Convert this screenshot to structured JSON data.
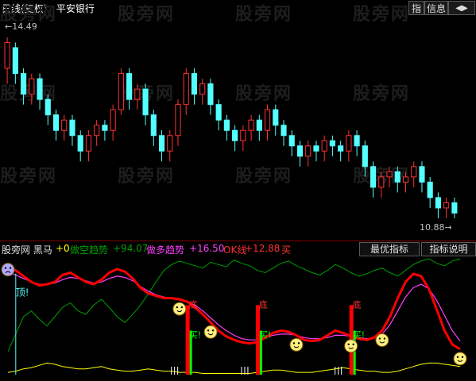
{
  "header": {
    "title": "日线(复权)",
    "stock": "平安银行",
    "btn_index": "指",
    "btn_info": "信息",
    "btn_sound": "◀▶"
  },
  "price_panel": {
    "high_label": "14.49",
    "low_label": "10.88"
  },
  "watermark": "股旁网",
  "indicator": {
    "name": "股旁网 黑马",
    "v0": "+0",
    "short_label": "做空趋势",
    "short_value": "+94.07",
    "long_label": "做多趋势",
    "long_value": "+16.50",
    "ok_label": "OK线",
    "ok_value": "+12.88",
    "buy_tag": "买",
    "btn_best": "最优指标",
    "btn_help": "指标说明",
    "tag_top": "顶!",
    "tag_bottom": "底",
    "tag_buy": "买!"
  },
  "colors": {
    "up": "#ff3232",
    "down": "#54ffff",
    "red_line": "#ff0000",
    "magenta_line": "#ff40ff",
    "green_line": "#00a000",
    "yellow_line": "#ffff00",
    "separator": "#800000"
  },
  "candles": [
    [
      13.8,
      14.3,
      13.6,
      14.4,
      13.5
    ],
    [
      14.2,
      13.7,
      13.6,
      14.3,
      13.5
    ],
    [
      13.7,
      13.3,
      13.2,
      13.8,
      13.1
    ],
    [
      13.3,
      13.6,
      13.2,
      13.7,
      13.1
    ],
    [
      13.6,
      13.2,
      13.1,
      13.7,
      13.0
    ],
    [
      13.2,
      12.9,
      12.8,
      13.3,
      12.7
    ],
    [
      12.9,
      12.6,
      12.5,
      13.0,
      12.4
    ],
    [
      12.6,
      12.8,
      12.5,
      12.9,
      12.4
    ],
    [
      12.8,
      12.5,
      12.4,
      12.9,
      12.3
    ],
    [
      12.5,
      12.2,
      12.1,
      12.6,
      12.0
    ],
    [
      12.2,
      12.5,
      12.1,
      12.6,
      12.0
    ],
    [
      12.5,
      12.7,
      12.4,
      12.8,
      12.3
    ],
    [
      12.7,
      12.6,
      12.5,
      12.8,
      12.4
    ],
    [
      12.6,
      13.0,
      12.5,
      13.1,
      12.4
    ],
    [
      13.0,
      13.7,
      12.9,
      13.8,
      12.9
    ],
    [
      13.7,
      13.2,
      13.1,
      13.8,
      13.0
    ],
    [
      13.2,
      13.4,
      13.1,
      13.5,
      13.0
    ],
    [
      13.4,
      12.9,
      12.8,
      13.5,
      12.7
    ],
    [
      12.9,
      12.5,
      12.4,
      13.0,
      12.3
    ],
    [
      12.5,
      12.2,
      12.1,
      12.6,
      12.0
    ],
    [
      12.2,
      12.5,
      12.1,
      12.6,
      12.0
    ],
    [
      12.5,
      13.1,
      12.4,
      13.2,
      12.3
    ],
    [
      13.1,
      13.7,
      13.0,
      13.8,
      12.9
    ],
    [
      13.7,
      13.3,
      13.2,
      13.8,
      13.1
    ],
    [
      13.3,
      13.5,
      13.2,
      13.6,
      13.1
    ],
    [
      13.5,
      13.1,
      13.0,
      13.6,
      12.9
    ],
    [
      13.1,
      12.8,
      12.7,
      13.2,
      12.6
    ],
    [
      12.8,
      12.6,
      12.5,
      12.9,
      12.4
    ],
    [
      12.6,
      12.4,
      12.3,
      12.7,
      12.2
    ],
    [
      12.4,
      12.6,
      12.3,
      12.7,
      12.2
    ],
    [
      12.6,
      12.8,
      12.5,
      12.9,
      12.4
    ],
    [
      12.8,
      12.6,
      12.5,
      12.9,
      12.4
    ],
    [
      12.6,
      13.0,
      12.5,
      13.1,
      12.4
    ],
    [
      13.0,
      12.7,
      12.6,
      13.1,
      12.5
    ],
    [
      12.7,
      12.5,
      12.4,
      12.8,
      12.3
    ],
    [
      12.5,
      12.3,
      12.2,
      12.6,
      12.1
    ],
    [
      12.3,
      12.1,
      12.0,
      12.4,
      11.9
    ],
    [
      12.1,
      12.3,
      12.0,
      12.4,
      11.9
    ],
    [
      12.3,
      12.2,
      12.1,
      12.4,
      12.0
    ],
    [
      12.2,
      12.4,
      12.1,
      12.5,
      12.0
    ],
    [
      12.4,
      12.3,
      12.2,
      12.5,
      12.1
    ],
    [
      12.3,
      12.2,
      12.1,
      12.4,
      12.0
    ],
    [
      12.2,
      12.5,
      12.1,
      12.6,
      12.0
    ],
    [
      12.5,
      12.3,
      12.2,
      12.6,
      12.1
    ],
    [
      12.3,
      11.9,
      11.8,
      12.4,
      11.7
    ],
    [
      11.9,
      11.5,
      11.4,
      12.0,
      11.3
    ],
    [
      11.5,
      11.7,
      11.4,
      11.8,
      11.3
    ],
    [
      11.7,
      11.8,
      11.6,
      11.9,
      11.5
    ],
    [
      11.8,
      11.6,
      11.5,
      11.9,
      11.4
    ],
    [
      11.6,
      11.7,
      11.5,
      11.8,
      11.4
    ],
    [
      11.7,
      11.9,
      11.6,
      12.0,
      11.5
    ],
    [
      11.9,
      11.6,
      11.5,
      12.0,
      11.4
    ],
    [
      11.6,
      11.3,
      11.2,
      11.7,
      11.1
    ],
    [
      11.3,
      11.1,
      11.0,
      11.4,
      10.9
    ],
    [
      11.1,
      11.2,
      11.0,
      11.3,
      10.9
    ],
    [
      11.2,
      11.0,
      10.9,
      11.3,
      10.9
    ]
  ],
  "indicator_series": {
    "red": [
      92,
      90,
      85,
      80,
      77,
      78,
      80,
      86,
      88,
      84,
      80,
      78,
      82,
      88,
      91,
      89,
      83,
      75,
      70,
      68,
      66,
      66,
      65,
      63,
      58,
      52,
      45,
      38,
      33,
      30,
      28,
      27,
      28,
      32,
      36,
      38,
      37,
      34,
      30,
      29,
      30,
      34,
      38,
      36,
      33,
      31,
      30,
      32,
      38,
      50,
      66,
      80,
      87,
      85,
      74,
      56,
      38,
      26,
      22
    ],
    "magenta": [
      88,
      86,
      83,
      80,
      78,
      78,
      79,
      82,
      84,
      83,
      81,
      79,
      80,
      83,
      85,
      84,
      81,
      76,
      72,
      69,
      67,
      66,
      65,
      63,
      60,
      55,
      49,
      43,
      38,
      34,
      31,
      30,
      30,
      32,
      34,
      35,
      35,
      34,
      32,
      31,
      31,
      32,
      34,
      34,
      33,
      32,
      31,
      32,
      35,
      43,
      55,
      67,
      75,
      78,
      74,
      64,
      51,
      38,
      29
    ],
    "green": [
      20,
      35,
      50,
      55,
      48,
      42,
      50,
      58,
      62,
      55,
      52,
      60,
      65,
      58,
      50,
      45,
      52,
      60,
      70,
      80,
      90,
      95,
      98,
      96,
      94,
      92,
      97,
      95,
      93,
      99,
      96,
      94,
      90,
      88,
      92,
      96,
      98,
      94,
      91,
      88,
      86,
      90,
      95,
      92,
      88,
      85,
      87,
      90,
      92,
      88,
      85,
      90,
      95,
      98,
      100,
      96,
      94,
      98,
      100
    ],
    "yellow": [
      2,
      3,
      5,
      6,
      8,
      10,
      9,
      7,
      6,
      5,
      5,
      6,
      7,
      5,
      4,
      3,
      3,
      4,
      5,
      4,
      3,
      3,
      2,
      2,
      2,
      1,
      1,
      1,
      1,
      1,
      1,
      1,
      2,
      3,
      4,
      4,
      3,
      2,
      2,
      2,
      3,
      4,
      5,
      6,
      5,
      4,
      3,
      3,
      2,
      2,
      3,
      5,
      7,
      9,
      10,
      10,
      9,
      8,
      7
    ]
  },
  "indicator_marks": {
    "top_index": 1,
    "bottom_indices": [
      23,
      32,
      44
    ],
    "smile_indices": [
      22,
      26,
      37,
      44,
      48,
      58
    ],
    "down_smile_index": 0
  }
}
